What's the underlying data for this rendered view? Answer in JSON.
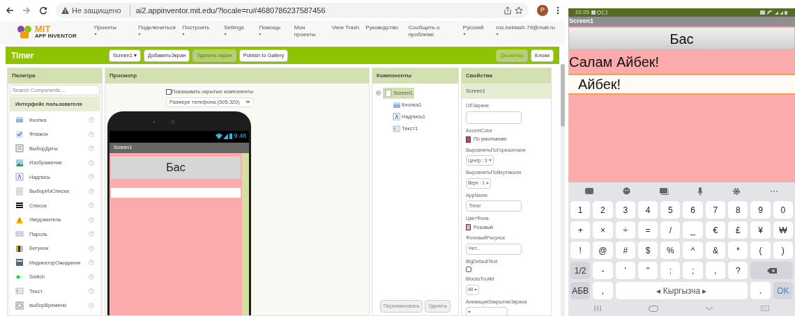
{
  "browser": {
    "not_secure": "Не защищено",
    "url": "ai2.appinventor.mit.edu/?locale=ru#4680786237587456",
    "profile": "P"
  },
  "header": {
    "logo_title": "MIT",
    "logo_subtitle": "APP INVENTOR",
    "menu": [
      {
        "label": "Проекты",
        "dropdown": true
      },
      {
        "label": "Подключиться",
        "dropdown": true
      },
      {
        "label": "Построить",
        "dropdown": true
      },
      {
        "label": "Settings",
        "dropdown": true
      },
      {
        "label": "Помощь",
        "dropdown": true
      },
      {
        "label": "Мои проекты",
        "dropdown": false
      },
      {
        "label": "View Trash",
        "dropdown": false
      },
      {
        "label": "Руководство",
        "dropdown": false
      },
      {
        "label": "Сообщить о проблеме",
        "dropdown": false
      },
      {
        "label": "Русский",
        "dropdown": true
      },
      {
        "label": "ros.bektash.79@mail.ru",
        "dropdown": true
      }
    ]
  },
  "toolbar": {
    "project": "Timer",
    "buttons": [
      {
        "label": "Screen1 ▾",
        "disabled": false
      },
      {
        "label": "ДобавитьЭкран",
        "disabled": false
      },
      {
        "label": "Удалить экран",
        "disabled": true
      },
      {
        "label": "Publish to Gallery",
        "disabled": false
      }
    ],
    "views": [
      {
        "label": "Дизайнер",
        "selected": true
      },
      {
        "label": "Блоки",
        "selected": false
      }
    ]
  },
  "palette": {
    "title": "Палитра",
    "search_placeholder": "Search Components...",
    "category": "Интерфейс пользователя",
    "items": [
      {
        "kind": "button",
        "label": "Кнопка"
      },
      {
        "kind": "checkbox",
        "label": "Флажок"
      },
      {
        "kind": "datepicker",
        "label": "ВыборДаты"
      },
      {
        "kind": "image",
        "label": "Изображение"
      },
      {
        "kind": "label",
        "label": "Надпись"
      },
      {
        "kind": "listpicker",
        "label": "ВыборИзСписка"
      },
      {
        "kind": "listview",
        "label": "Список"
      },
      {
        "kind": "notifier",
        "label": "Уведомитель"
      },
      {
        "kind": "password",
        "label": "Пароль"
      },
      {
        "kind": "slider",
        "label": "Бегунок"
      },
      {
        "kind": "spinner",
        "label": "ИндикаторОжидания"
      },
      {
        "kind": "switch",
        "label": "Switch"
      },
      {
        "kind": "textbox",
        "label": "Текст"
      },
      {
        "kind": "timepicker",
        "label": "выборВремени"
      }
    ]
  },
  "viewer": {
    "title": "Просмотр",
    "show_hidden": {
      "label": "Показывать скрытые компоненты",
      "checked": false
    },
    "size_select": "Размере телефона (505,320)",
    "phone": {
      "time": "9:48",
      "screen_title": "Screen1",
      "button": "Бас"
    }
  },
  "components": {
    "title": "Компоненты",
    "tree": [
      {
        "kind": "screen",
        "label": "Screen1",
        "selected": true,
        "expanded": true,
        "children": [
          {
            "kind": "button",
            "label": "Кнопка1",
            "selected": false
          },
          {
            "kind": "label",
            "label": "Надпись1",
            "selected": false
          },
          {
            "kind": "textbox",
            "label": "Текст1",
            "selected": false
          }
        ]
      }
    ],
    "buttons": [
      {
        "label": "Переименовать",
        "disabled": false
      },
      {
        "label": "Удалить",
        "disabled": false
      }
    ]
  },
  "properties": {
    "title": "Свойства",
    "component": "Screen1",
    "items": [
      {
        "kind": "textarea",
        "label": "ОбЭкране"
      },
      {
        "kind": "color",
        "label": "AccentColor",
        "value": "По умолчанию",
        "color": "#e0336a"
      },
      {
        "kind": "select",
        "label": "ВыровнятьПоГоризонтали",
        "value": "Центр : 3"
      },
      {
        "kind": "select",
        "label": "ВыровнятьПоВертикали",
        "value": "Верх : 1"
      },
      {
        "kind": "text",
        "label": "AppName",
        "value": "Timer"
      },
      {
        "kind": "color",
        "label": "ЦветФона",
        "value": "Розовый",
        "color": "#f4a9ad"
      },
      {
        "kind": "text",
        "label": "ФоновыйРисунок",
        "value": "Нет..."
      },
      {
        "kind": "checkbox",
        "label": "BigDefaultText",
        "checked": false
      },
      {
        "kind": "select",
        "label": "BlocksToolkit",
        "value": "All"
      },
      {
        "kind": "select",
        "label": "АнимацияЗакрытияЭкрана"
      }
    ]
  },
  "device": {
    "time": "22:25",
    "screen_title": "Screen1",
    "button": "Бас",
    "label": "Салам Айбек!",
    "textbox_value": "Айбек!",
    "keyboard": {
      "rows": [
        {
          "keys": [
            {
              "kind": "char",
              "label": "1"
            },
            {
              "kind": "char",
              "label": "2"
            },
            {
              "kind": "char",
              "label": "3"
            },
            {
              "kind": "char",
              "label": "4"
            },
            {
              "kind": "char",
              "label": "5"
            },
            {
              "kind": "char",
              "label": "6"
            },
            {
              "kind": "char",
              "label": "7"
            },
            {
              "kind": "char",
              "label": "8"
            },
            {
              "kind": "char",
              "label": "9"
            },
            {
              "kind": "char",
              "label": "0"
            }
          ]
        },
        {
          "keys": [
            {
              "kind": "char",
              "label": "+"
            },
            {
              "kind": "char",
              "label": "×"
            },
            {
              "kind": "char",
              "label": "÷"
            },
            {
              "kind": "char",
              "label": "="
            },
            {
              "kind": "char",
              "label": "/"
            },
            {
              "kind": "char",
              "label": "_"
            },
            {
              "kind": "char",
              "label": "€"
            },
            {
              "kind": "char",
              "label": "£"
            },
            {
              "kind": "char",
              "label": "¥"
            },
            {
              "kind": "char",
              "label": "₩"
            }
          ]
        },
        {
          "keys": [
            {
              "kind": "char",
              "label": "!"
            },
            {
              "kind": "char",
              "label": "@"
            },
            {
              "kind": "char",
              "label": "#"
            },
            {
              "kind": "char",
              "label": "$"
            },
            {
              "kind": "char",
              "label": "%"
            },
            {
              "kind": "char",
              "label": "^"
            },
            {
              "kind": "char",
              "label": "&"
            },
            {
              "kind": "char",
              "label": "*"
            },
            {
              "kind": "char",
              "label": "("
            },
            {
              "kind": "char",
              "label": ")"
            }
          ]
        },
        {
          "keys": [
            {
              "kind": "function",
              "label": "1/2"
            },
            {
              "kind": "char",
              "label": "-"
            },
            {
              "kind": "char",
              "label": "'"
            },
            {
              "kind": "char",
              "label": "\""
            },
            {
              "kind": "char",
              "label": ":"
            },
            {
              "kind": "char",
              "label": ";"
            },
            {
              "kind": "char",
              "label": ","
            },
            {
              "kind": "char",
              "label": "?"
            },
            {
              "kind": "backspace"
            }
          ]
        },
        {
          "keys": [
            {
              "kind": "function",
              "label": "АБВ"
            },
            {
              "kind": "char",
              "label": ","
            },
            {
              "kind": "space",
              "label": "◂ Кыргызча ▸"
            },
            {
              "kind": "char",
              "label": "."
            },
            {
              "kind": "action",
              "label": "OK"
            }
          ]
        }
      ]
    }
  }
}
